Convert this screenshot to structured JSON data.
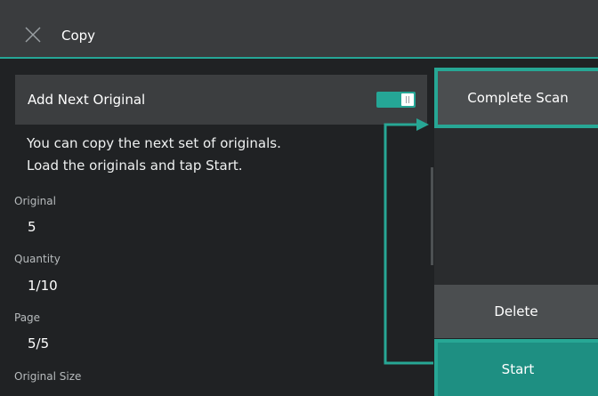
{
  "header": {
    "title": "Copy",
    "close_icon": "close-icon"
  },
  "add_next": {
    "label": "Add Next Original",
    "toggle_on": true
  },
  "message": {
    "line1": "You can copy the next set of originals.",
    "line2": "Load the originals and tap Start."
  },
  "fields": {
    "original": {
      "label": "Original",
      "value": "5"
    },
    "quantity": {
      "label": "Quantity",
      "value": "1/10"
    },
    "page": {
      "label": "Page",
      "value": "5/5"
    },
    "original_size": {
      "label": "Original Size"
    }
  },
  "actions": {
    "complete_scan": "Complete Scan",
    "delete": "Delete",
    "start": "Start"
  },
  "colors": {
    "accent": "#25a696",
    "header_bg": "#3a3c3e",
    "body_bg": "#202224"
  }
}
